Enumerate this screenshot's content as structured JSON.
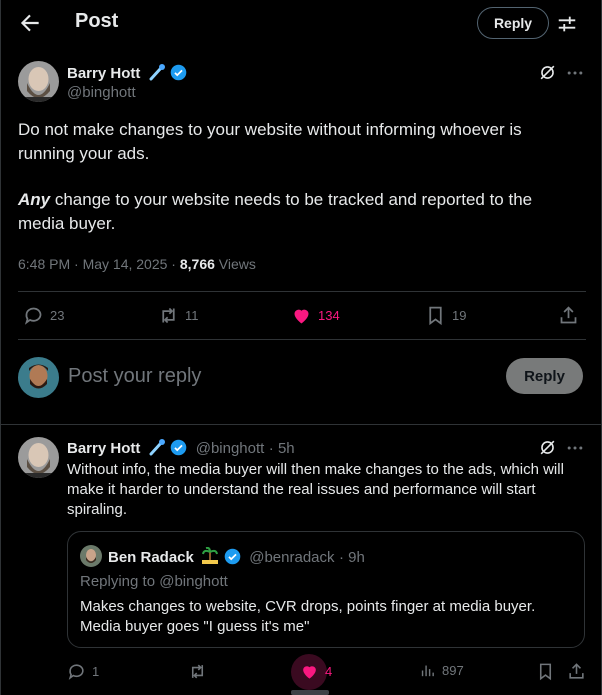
{
  "header": {
    "title": "Post",
    "reply_label": "Reply"
  },
  "post": {
    "author_name": "Barry Hott",
    "author_handle": "@binghott",
    "text_line1": "Do not make changes to your website without informing whoever is",
    "text_line2": "running your ads.",
    "emphasis": "Any",
    "text_line3_rest": " change to your website needs to be tracked and reported to the",
    "text_line4": "media buyer.",
    "timestamp": "6:48 PM · May 14, 2025 · ",
    "views_count": "8,766",
    "views_label": " Views",
    "stats": {
      "replies": "23",
      "reposts": "11",
      "likes": "134",
      "bookmarks": "19"
    }
  },
  "composer": {
    "placeholder": "Post your reply",
    "reply_label": "Reply"
  },
  "reply_post": {
    "author_name": "Barry Hott",
    "author_handle": "@binghott",
    "time": "· 5h",
    "line1": "Without info, the media buyer will then make changes to the ads, which will",
    "line2": "make it harder to understand the real issues and performance will start",
    "line3": "spiraling.",
    "quote": {
      "author_name": "Ben Radack",
      "author_handle": "@benradack",
      "time": "· 9h",
      "replying_to": "Replying to @binghott",
      "line1": "Makes changes to website, CVR drops, points finger at media buyer.",
      "line2": "Media buyer goes \"I guess it's me\""
    },
    "stats": {
      "replies": "1",
      "likes": "4",
      "views": "897"
    }
  },
  "colors": {
    "accent_pink": "#f91880",
    "verified_blue": "#1d9bf0",
    "muted": "#71767b"
  }
}
